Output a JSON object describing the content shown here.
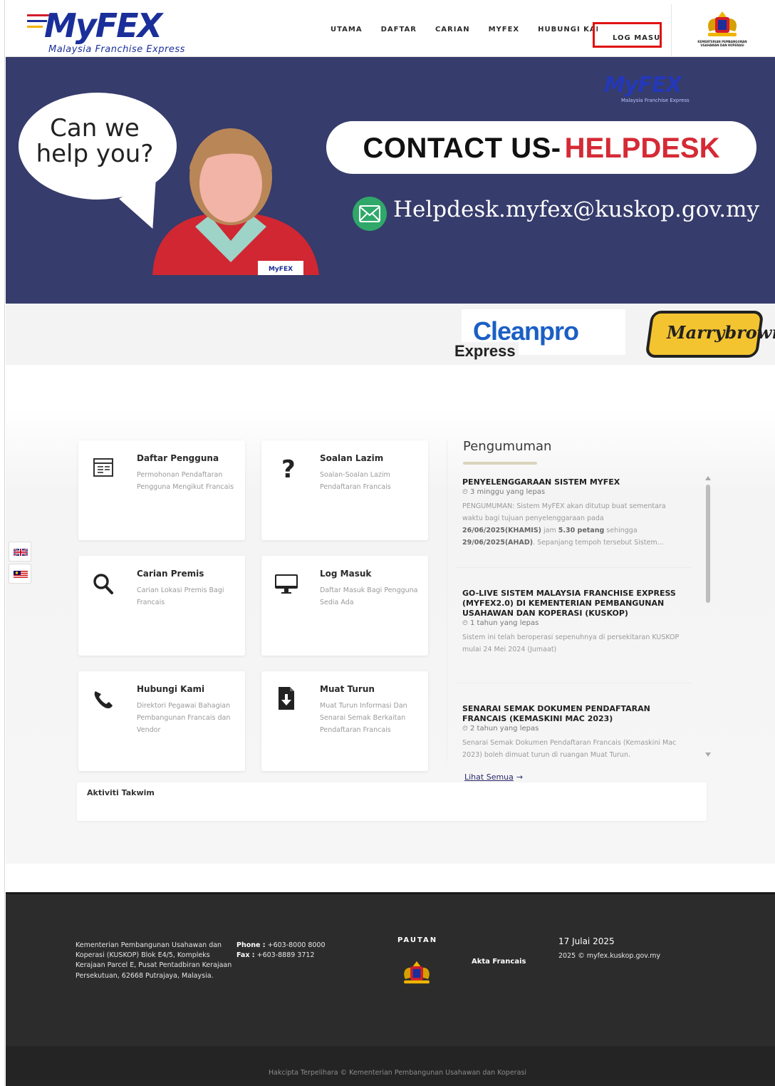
{
  "header": {
    "logo_text": "MyFEX",
    "logo_tagline": "Malaysia Franchise Express",
    "nav": [
      {
        "label": "UTAMA"
      },
      {
        "label": "DAFTAR"
      },
      {
        "label": "CARIAN"
      },
      {
        "label": "MYFEX"
      },
      {
        "label": "HUBUNGI KAMI"
      }
    ],
    "login_label": "LOG MASUK",
    "crest_label": "KEMENTERIAN PEMBANGUNAN USAHAWAN DAN KOPERASI",
    "highlight_color": "#e01212"
  },
  "hero": {
    "bubble_text": "Can we help you?",
    "logo_text": "MyFEX",
    "logo_tagline": "Malaysia Franchise Express",
    "contact_main": "CONTACT US-",
    "contact_accent": "HELPDESK",
    "email": "Helpdesk.myfex@kuskop.gov.my",
    "bg_color": "#363c6b",
    "accent_color": "#d52a35",
    "badge_text": "MyFEX"
  },
  "partners": {
    "cleanpro_text": "Cleanpro",
    "cleanpro_sub": "Express",
    "marrybrown_text": "Marrybrown"
  },
  "languages": [
    {
      "name": "english-flag-icon"
    },
    {
      "name": "malaysia-flag-icon"
    }
  ],
  "cards": [
    {
      "title": "Daftar Pengguna",
      "desc": "Permohonan Pendaftaran Pengguna Mengikut Francais",
      "icon": "form-icon"
    },
    {
      "title": "Soalan Lazim",
      "desc": "Soalan-Soalan Lazim Pendaftaran Francais",
      "icon": "question-icon"
    },
    {
      "title": "Carian Premis",
      "desc": "Carian Lokasi Premis Bagi Francais",
      "icon": "search-icon"
    },
    {
      "title": "Log Masuk",
      "desc": "Daftar Masuk Bagi Pengguna Sedia Ada",
      "icon": "monitor-icon"
    },
    {
      "title": "Hubungi Kami",
      "desc": "Direktori Pegawai Bahagian Pembangunan Francais dan Vendor",
      "icon": "phone-icon"
    },
    {
      "title": "Muat Turun",
      "desc": "Muat Turun Informasi Dan Senarai Semak Berkaitan Pendaftaran Francais",
      "icon": "download-icon"
    }
  ],
  "announcements": {
    "heading": "Pengumuman",
    "items": [
      {
        "title": "PENYELENGGARAAN SISTEM MYFEX",
        "time": "3 minggu yang lepas",
        "body_prefix": "PENGUMUMAN: Sistem MyFEX akan ditutup buat sementara waktu bagi tujuan penyelenggaraan pada ",
        "bold1": "26/06/2025(KHAMIS)",
        "mid1": " jam ",
        "bold2": "5.30 petang",
        "mid2": " sehingga ",
        "bold3": "29/06/2025(AHAD)",
        "body_suffix": ". Sepanjang tempoh tersebut Sistem..."
      },
      {
        "title": "GO-LIVE SISTEM MALAYSIA FRANCHISE EXPRESS (MYFEX2.0) DI KEMENTERIAN PEMBANGUNAN USAHAWAN DAN KOPERASI (KUSKOP)",
        "time": "1 tahun yang lepas",
        "body": "Sistem ini telah beroperasi sepenuhnya di persekitaran KUSKOP mulai 24 Mei 2024 (Jumaat)"
      },
      {
        "title": "SENARAI SEMAK DOKUMEN PENDAFTARAN FRANCAIS (KEMASKINI MAC 2023)",
        "time": "2 tahun yang lepas",
        "body": "Senarai Semak Dokumen Pendaftaran Francais (Kemaskini Mac 2023) boleh dimuat turun di ruangan Muat Turun."
      }
    ],
    "view_all": "Lihat Semua",
    "view_all_arrow": "→"
  },
  "calendar": {
    "title": "Aktiviti Takwim"
  },
  "footer": {
    "address": "Kementerian Pembangunan Usahawan dan Koperasi (KUSKOP) Blok E4/5, Kompleks Kerajaan Parcel E, Pusat Pentadbiran Kerajaan Persekutuan, 62668 Putrajaya, Malaysia.",
    "phone_label": "Phone :",
    "phone": "+603-8000 8000",
    "fax_label": "Fax :",
    "fax": "+603-8889 3712",
    "links_title": "PAUTAN",
    "link_label": "Akta Francais",
    "date": "17 Julai 2025",
    "site_copy": "2025 © myfex.kuskop.gov.my",
    "copyright": "Hakcipta Terpelihara © Kementerian Pembangunan Usahawan dan Koperasi"
  }
}
